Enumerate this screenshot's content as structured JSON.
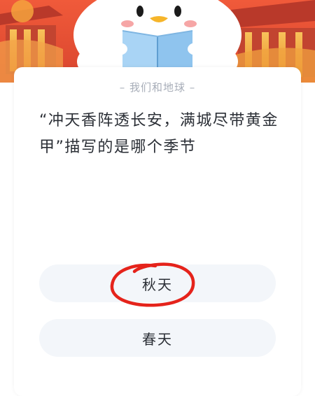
{
  "category": "我们和地球",
  "question": "“冲天香阵透长安，满城尽带黄金甲”描写的是哪个季节",
  "options": [
    {
      "label": "秋天",
      "marked": true
    },
    {
      "label": "春天",
      "marked": false
    }
  ],
  "colors": {
    "banner_red": "#e4563b",
    "banner_gold": "#f5b046",
    "option_bg": "#f3f6fa",
    "mark_red": "#e5231b"
  },
  "icons": [
    "penguin-mascot-icon",
    "book-icon"
  ]
}
